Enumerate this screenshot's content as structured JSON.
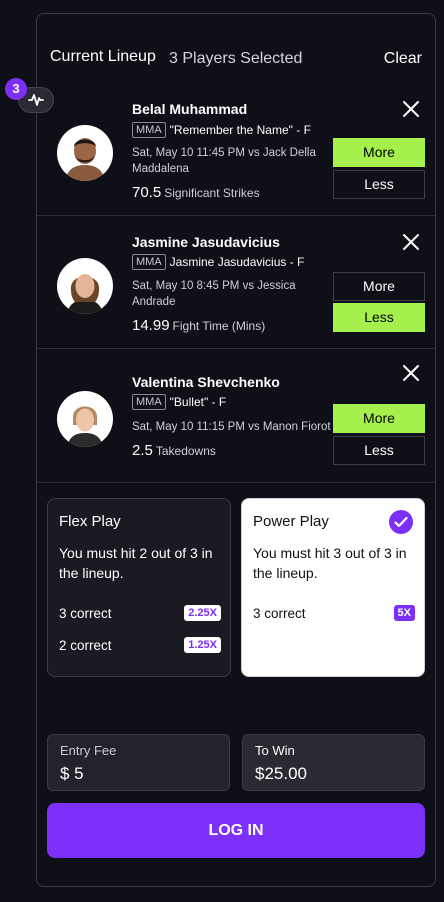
{
  "header": {
    "title": "Current Lineup",
    "count": "3 Players Selected",
    "clear": "Clear"
  },
  "notification_count": "3",
  "players": [
    {
      "name": "Belal Muhammad",
      "sport": "MMA",
      "nickname": "\"Remember the Name\" - F",
      "game": "Sat, May 10 11:45 PM vs Jack Della Maddalena",
      "stat_value": "70.5",
      "stat_label": "Significant Strikes",
      "more": "More",
      "less": "Less",
      "selected": "More"
    },
    {
      "name": "Jasmine Jasudavicius",
      "sport": "MMA",
      "nickname": "Jasmine Jasudavicius - F",
      "game": "Sat, May 10 8:45 PM vs Jessica Andrade",
      "stat_value": "14.99",
      "stat_label": "Fight Time (Mins)",
      "more": "More",
      "less": "Less",
      "selected": "Less"
    },
    {
      "name": "Valentina Shevchenko",
      "sport": "MMA",
      "nickname": "\"Bullet\" - F",
      "game": "Sat, May 10 11:15 PM vs Manon Fiorot",
      "stat_value": "2.5",
      "stat_label": "Takedowns",
      "more": "More",
      "less": "Less",
      "selected": "More"
    }
  ],
  "flex_play": {
    "title": "Flex Play",
    "description": "You must hit 2 out of 3 in the lineup.",
    "rows": [
      {
        "label": "3 correct",
        "multiplier": "2.25X"
      },
      {
        "label": "2 correct",
        "multiplier": "1.25X"
      }
    ]
  },
  "power_play": {
    "title": "Power Play",
    "description": "You must hit 3 out of 3 in the lineup.",
    "rows": [
      {
        "label": "3 correct",
        "multiplier": "5X"
      }
    ],
    "selected": true
  },
  "entry_fee": {
    "label": "Entry Fee",
    "value": "$ 5"
  },
  "to_win": {
    "label": "To Win",
    "value": "$25.00"
  },
  "login": "LOG IN",
  "colors": {
    "accent": "#7b2ff7",
    "selected_green": "#a6f04e",
    "background": "#0f0f17"
  },
  "icons": [
    "activity-icon",
    "close-icon",
    "check-icon"
  ]
}
